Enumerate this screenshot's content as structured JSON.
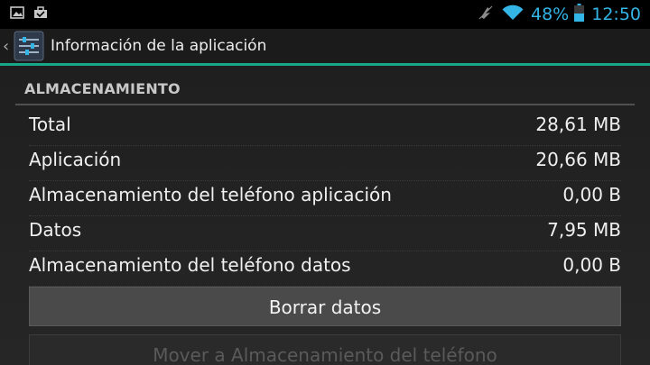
{
  "status_bar": {
    "left_icons": [
      "picture-icon",
      "briefcase-icon"
    ],
    "right_icons": [
      "vibrate-icon",
      "wifi-icon"
    ],
    "battery_percent": "48%",
    "time": "12:50",
    "accent_color": "#33b5e5"
  },
  "action_bar": {
    "title": "Información de la aplicación",
    "icon": "settings-app-icon",
    "divider_color": "#17a88a"
  },
  "storage": {
    "header": "ALMACENAMIENTO",
    "rows": [
      {
        "label": "Total",
        "value": "28,61 MB"
      },
      {
        "label": "Aplicación",
        "value": "20,66 MB"
      },
      {
        "label": "Almacenamiento del teléfono aplicación",
        "value": "0,00 B"
      },
      {
        "label": "Datos",
        "value": "7,95 MB"
      },
      {
        "label": "Almacenamiento del teléfono datos",
        "value": "0,00 B"
      }
    ]
  },
  "buttons": {
    "clear_data": "Borrar datos",
    "move_to_phone": "Mover a Almacenamiento del teléfono"
  }
}
